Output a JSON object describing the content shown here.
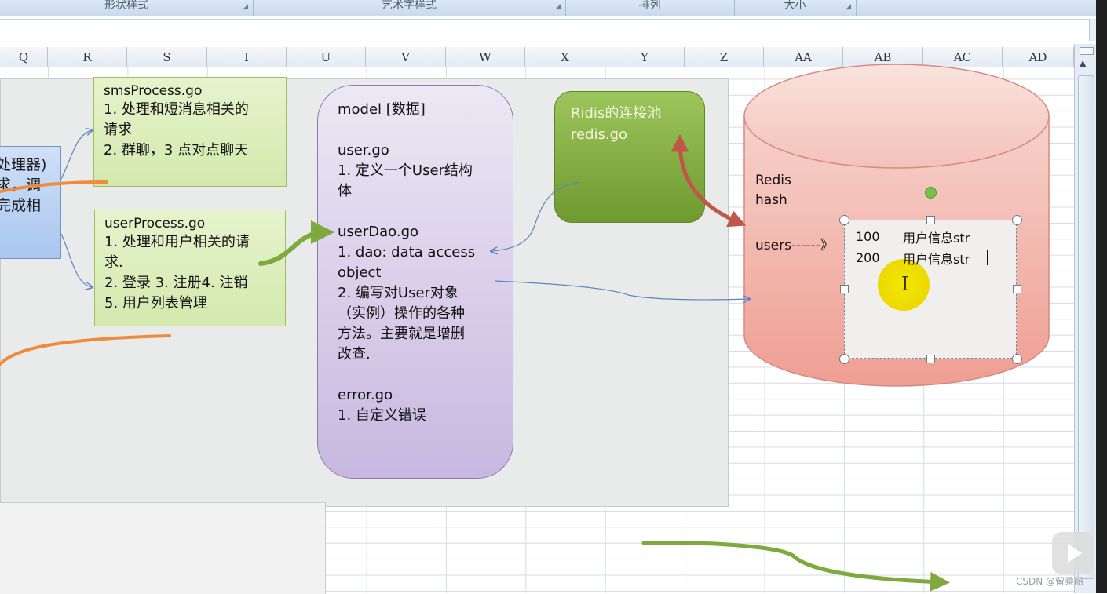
{
  "ribbon": {
    "groups": [
      "形状样式",
      "艺术字样式",
      "排列",
      "大小"
    ]
  },
  "formula_bar": {
    "scroll_glyph": "⌄"
  },
  "columns": [
    "Q",
    "R",
    "S",
    "T",
    "U",
    "V",
    "W",
    "X",
    "Y",
    "Z",
    "AA",
    "AB",
    "AC",
    "AD"
  ],
  "processor_box": {
    "lines": [
      "处理器)",
      "求，调",
      "完成相"
    ]
  },
  "sms_note": {
    "title": "smsProcess.go",
    "lines": [
      "1. 处理和短消息相关的",
      "请求",
      "2. 群聊，3 点对点聊天"
    ]
  },
  "user_note": {
    "title": "userProcess.go",
    "lines": [
      "1. 处理和用户相关的请",
      "求.",
      "2. 登录 3. 注册4.  注销",
      "5. 用户列表管理"
    ]
  },
  "model_box": {
    "lines": [
      "model [数据]",
      "",
      "user.go",
      "1. 定义一个User结构",
      "体",
      "",
      "userDao.go",
      "1. dao: data access",
      "object",
      "2. 编写对User对象",
      "（实例）操作的各种",
      "方法。主要就是增删",
      "改查.",
      "",
      "error.go",
      "1. 自定义错误"
    ]
  },
  "pool_box": {
    "title": "Ridis的连接池",
    "file": "redis.go"
  },
  "redis": {
    "label": "Redis",
    "type": "hash",
    "key_label": "users------》",
    "rows": [
      {
        "id": "100",
        "value": "用户信息str"
      },
      {
        "id": "200",
        "value": "用户信息str"
      }
    ],
    "cursor_glyph": "I"
  },
  "scroll": {
    "up_glyph": "▲"
  },
  "watermark": {
    "text": "CSDN @留乘船"
  },
  "colors": {
    "note_green": "#d3e9ae",
    "model_purple": "#c8b8e0",
    "pool_green": "#7ea93d",
    "redis_pink": "#f2aaa0",
    "arrow_orange": "#f08a3c",
    "arrow_green": "#7ea93d",
    "arrow_red": "#c0564a",
    "connector_blue": "#5a85c0"
  }
}
